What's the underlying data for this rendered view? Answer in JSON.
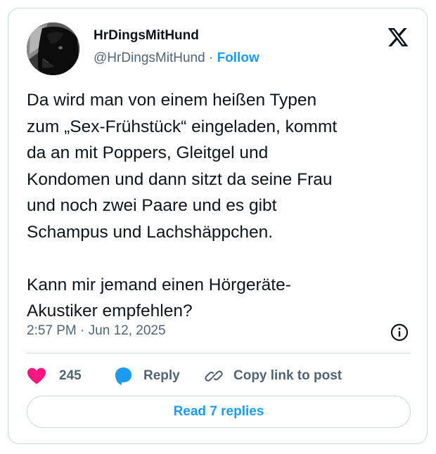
{
  "author": {
    "display_name": "HrDingsMitHund",
    "handle": "@HrDingsMitHund",
    "separator": "·",
    "follow_label": "Follow"
  },
  "post": {
    "text": "Da wird man von einem heißen Typen\nzum „Sex-Frühstück“ eingeladen, kommt\nda an mit Poppers, Gleitgel und\nKondomen und dann sitzt da seine Frau\nund noch zwei Paare und es gibt\nSchampus und Lachshäppchen.\n\nKann mir jemand einen Hörgeräte-\nAkustiker empfehlen?",
    "time": "2:57 PM",
    "date_separator": "·",
    "date": "Jun 12, 2025"
  },
  "actions": {
    "like_count": "245",
    "reply_label": "Reply",
    "copy_label": "Copy link to post"
  },
  "read_replies_label": "Read 7 replies",
  "icons": {
    "platform": "x-logo-icon",
    "info": "info-icon",
    "like": "heart-icon",
    "reply": "speech-bubble-icon",
    "copy": "link-icon"
  },
  "colors": {
    "accent": "#1d9bf0",
    "like": "#f91880",
    "text": "#0f1419",
    "secondary_text": "#536471",
    "border": "#cfd9de"
  }
}
